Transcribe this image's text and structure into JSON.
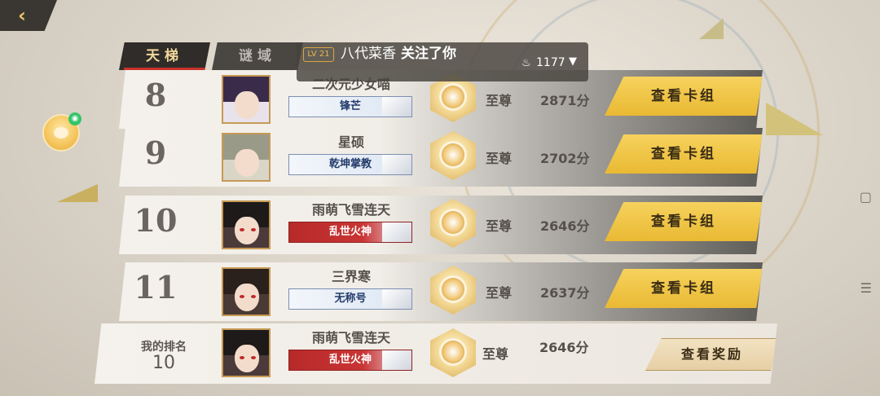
{
  "nav": {
    "back_icon": "back-arrow-icon"
  },
  "tabs": [
    {
      "label": "天梯",
      "active": true
    },
    {
      "label": "谜域",
      "active": false
    }
  ],
  "notification": {
    "level": "LV 21",
    "user": "八代菜香",
    "action": "关注了你",
    "popularity": "1177",
    "fire_icon": "flame-icon",
    "dropdown_icon": "triangle-down-icon"
  },
  "rows": [
    {
      "rank": "8",
      "name": "二次元少女喵",
      "title": "锋芒",
      "title_style": "wave",
      "tier": "至尊",
      "score": "2871分",
      "button": "查看卡组",
      "hair": "#3b2b4a"
    },
    {
      "rank": "9",
      "name": "星硕",
      "title": "乾坤掌教",
      "title_style": "wave",
      "tier": "至尊",
      "score": "2702分",
      "button": "查看卡组",
      "hair": "#9a9a88"
    },
    {
      "rank": "10",
      "name": "雨萌飞雪连天",
      "title": "乱世火神",
      "title_style": "red",
      "tier": "至尊",
      "score": "2646分",
      "button": "查看卡组",
      "hair": "#1e1a1a"
    },
    {
      "rank": "11",
      "name": "三界寒",
      "title": "无称号",
      "title_style": "wave",
      "tier": "至尊",
      "score": "2637分",
      "button": "查看卡组",
      "hair": "#2a201c"
    }
  ],
  "my_rank": {
    "label": "我的排名",
    "rank": "10",
    "name": "雨萌飞雪连天",
    "title": "乱世火神",
    "tier": "至尊",
    "score": "2646分",
    "button": "查看奖励"
  },
  "system_icons": {
    "square": "▢",
    "menu": "☰"
  }
}
